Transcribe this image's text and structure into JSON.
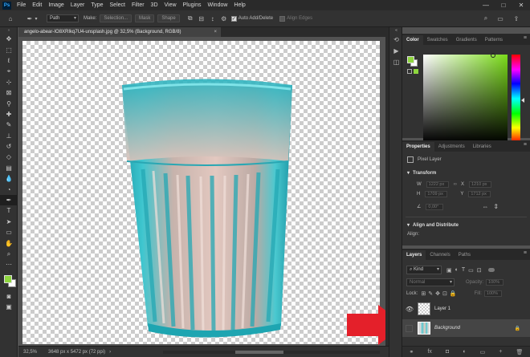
{
  "app": {
    "logo": "Ps"
  },
  "menu": [
    "File",
    "Edit",
    "Image",
    "Layer",
    "Type",
    "Select",
    "Filter",
    "3D",
    "View",
    "Plugins",
    "Window",
    "Help"
  ],
  "window_controls": [
    "—",
    "□",
    "✕"
  ],
  "options_bar": {
    "mode": "Path",
    "make_label": "Make:",
    "selection_btn": "Selection...",
    "mask_btn": "Mask",
    "shape_btn": "Shape",
    "auto_add_delete": "Auto Add/Delete",
    "align_edges": "Align Edges"
  },
  "document": {
    "tab_title": "angelo-abear-IO8XRIkq7U4-unsplash.jpg @ 32,5% (Background, RGB/8)",
    "tab_close": "×"
  },
  "status": {
    "zoom": "32,5%",
    "dims": "3648 px x 5472 px (72 ppi)",
    "arrow": "›"
  },
  "color_panel": {
    "tabs": [
      "Color",
      "Swatches",
      "Gradients",
      "Patterns"
    ],
    "foreground": "#8ed63e",
    "background": "#ffffff",
    "hue_color": "#7bdc1a"
  },
  "properties_panel": {
    "tabs": [
      "Properties",
      "Adjustments",
      "Libraries"
    ],
    "layer_type": "Pixel Layer",
    "transform_title": "Transform",
    "w_label": "W",
    "w_value": "1222 px",
    "x_label": "X",
    "x_value": "1210 px",
    "h_label": "H",
    "h_value": "1709 px",
    "y_label": "Y",
    "y_value": "1712 px",
    "angle_value": "0,00°",
    "align_title": "Align and Distribute",
    "align_label": "Align:"
  },
  "layers_panel": {
    "tabs": [
      "Layers",
      "Channels",
      "Paths"
    ],
    "filter_kind": "Kind",
    "blend_mode": "Normal",
    "opacity_label": "Opacity:",
    "opacity_value": "100%",
    "lock_label": "Lock:",
    "fill_label": "Fill:",
    "fill_value": "100%",
    "layers": [
      {
        "name": "Layer 1",
        "visible": true
      },
      {
        "name": "Background",
        "visible": false
      }
    ],
    "footer_icons": [
      "⊖",
      "fx",
      "◐",
      "◑",
      "▭",
      "+",
      "🗑"
    ]
  },
  "annotation": {
    "arrow_color": "#e4202a"
  },
  "tools": [
    "move",
    "marquee",
    "lasso",
    "quick-select",
    "crop",
    "frame",
    "eyedropper",
    "healing",
    "brush",
    "clone-stamp",
    "history-brush",
    "eraser",
    "gradient",
    "blur",
    "dodge",
    "pen",
    "type",
    "path-select",
    "rectangle",
    "hand",
    "zoom",
    "more"
  ]
}
